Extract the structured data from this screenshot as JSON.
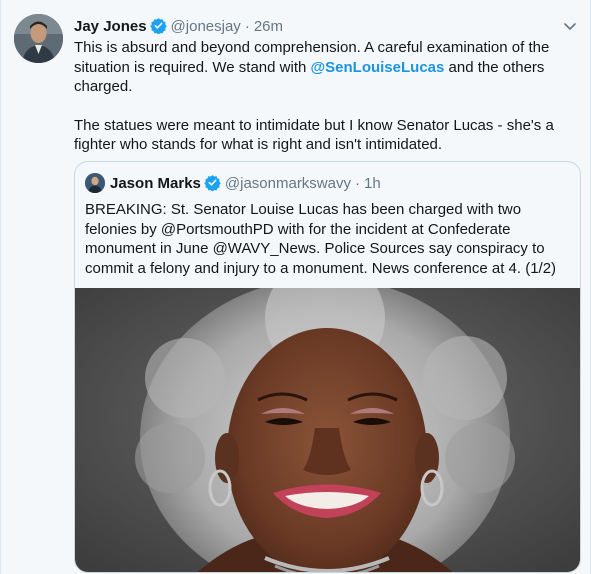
{
  "tweet": {
    "author_name": "Jay Jones",
    "author_handle": "@jonesjay",
    "separator": "·",
    "time": "26m",
    "text_p1_before": "This is absurd and beyond comprehension. A careful examination of the situation is required. We stand with ",
    "text_p1_mention": "@SenLouiseLucas",
    "text_p1_after": " and the others charged.",
    "text_p2": "The statues were meant to intimidate but I know Senator Lucas - she's a fighter who stands for what is right and isn't intimidated."
  },
  "quoted_tweet": {
    "author_name": "Jason Marks",
    "author_handle": "@jasonmarkswavy",
    "separator": "·",
    "time": "1h",
    "text": "BREAKING: St. Senator Louise Lucas has been charged with two felonies by @PortsmouthPD with for the incident at Confederate monument in June @WAVY_News. Police Sources say conspiracy to commit a felony and injury to a monument. News conference at 4. (1/2)"
  },
  "icons": {
    "verified": "verified-badge-icon",
    "more": "chevron-down-icon"
  },
  "colors": {
    "background": "#f5f8fa",
    "link": "#1b95e0",
    "verified": "#1da1f2",
    "secondary_text": "#657786",
    "border": "#ccd6dd"
  }
}
